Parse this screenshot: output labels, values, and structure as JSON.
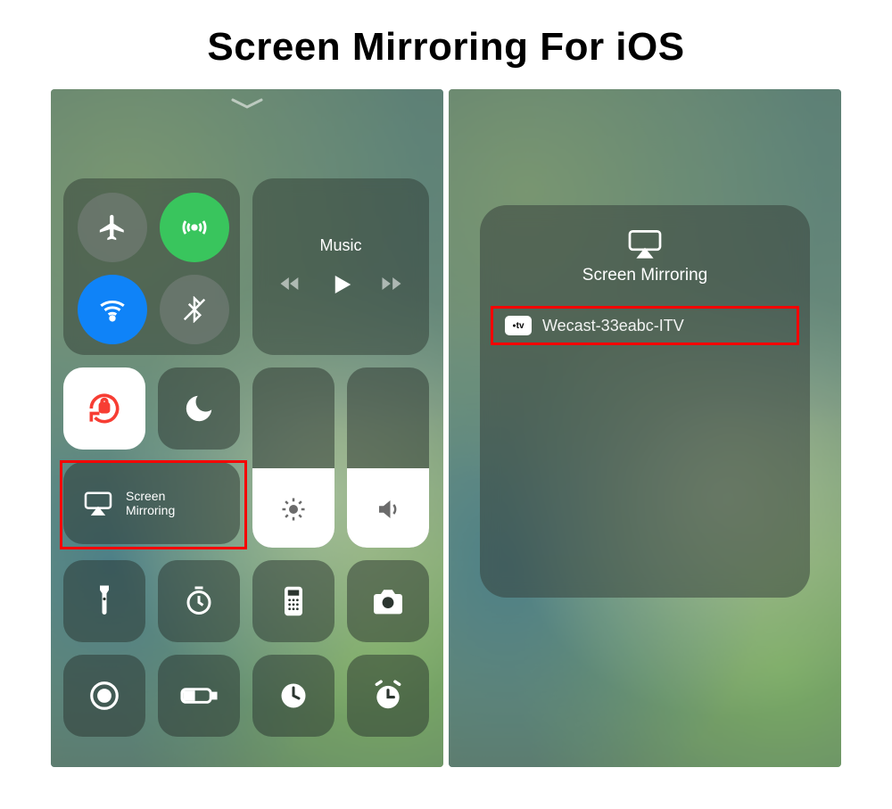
{
  "page": {
    "title": "Screen Mirroring For iOS"
  },
  "left": {
    "music_label": "Music",
    "screen_mirroring_label": "Screen\nMirroring",
    "brightness_percent": 44,
    "volume_percent": 44,
    "icons": {
      "airplane": "airplane-icon",
      "cellular": "cellular-icon",
      "wifi": "wifi-icon",
      "bluetooth": "bluetooth-icon",
      "lock": "rotation-lock-icon",
      "dnd": "moon-icon",
      "mirror": "airplay-icon",
      "brightness": "sun-icon",
      "volume": "speaker-icon"
    },
    "shortcuts": [
      "flashlight",
      "timer",
      "calculator",
      "camera",
      "record",
      "low-power",
      "stopwatch",
      "alarm"
    ]
  },
  "right": {
    "panel_title": "Screen Mirroring",
    "device_badge": "tv",
    "device_name": "Wecast-33eabc-ITV"
  },
  "colors": {
    "highlight": "#ff0000",
    "green": "#34c759",
    "blue": "#0a84ff",
    "lock_red": "#ff3b30"
  }
}
